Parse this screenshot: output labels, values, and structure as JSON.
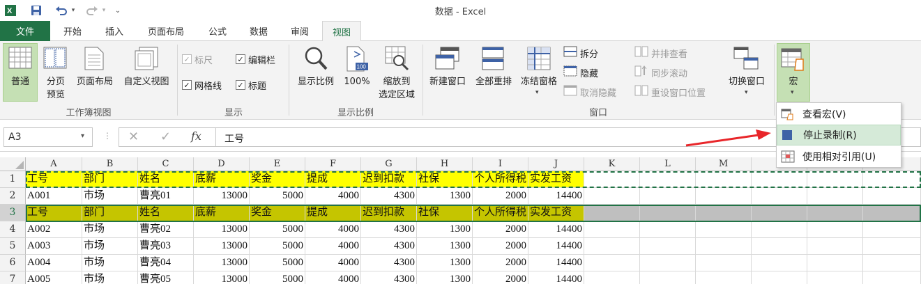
{
  "window": {
    "title": "数据 - Excel"
  },
  "quick_access": {
    "app_icon": "excel-icon",
    "save": "save-icon",
    "undo": "undo-icon",
    "redo": "redo-icon",
    "customize": "customize-qat-icon"
  },
  "tabs": [
    {
      "label": "文件"
    },
    {
      "label": "开始"
    },
    {
      "label": "插入"
    },
    {
      "label": "页面布局"
    },
    {
      "label": "公式"
    },
    {
      "label": "数据"
    },
    {
      "label": "审阅"
    },
    {
      "label": "视图",
      "active": true
    }
  ],
  "ribbon": {
    "groups": {
      "workbook_views": {
        "label": "工作簿视图",
        "normal": "普通",
        "page_break_1": "分页",
        "page_break_2": "预览",
        "page_layout": "页面布局",
        "custom_view": "自定义视图"
      },
      "show": {
        "label": "显示",
        "ruler": "标尺",
        "ruler_checked": true,
        "ruler_disabled": true,
        "formula_bar": "编辑栏",
        "formula_bar_checked": true,
        "gridlines": "网格线",
        "gridlines_checked": true,
        "headings": "标题",
        "headings_checked": true
      },
      "zoom": {
        "label": "显示比例",
        "zoom": "显示比例",
        "hundred": "100%",
        "hundred_icon_text": "100",
        "zoom_selection_1": "缩放到",
        "zoom_selection_2": "选定区域"
      },
      "window": {
        "label": "窗口",
        "new_window": "新建窗口",
        "arrange_all": "全部重排",
        "freeze_panes": "冻结窗格",
        "split": "拆分",
        "hide": "隐藏",
        "unhide": "取消隐藏",
        "view_side_by_side": "并排查看",
        "sync_scroll": "同步滚动",
        "reset_position": "重设窗口位置",
        "switch_windows": "切换窗口"
      },
      "macros": {
        "macro": "宏"
      }
    }
  },
  "formula_bar": {
    "name_box": "A3",
    "cancel": "✕",
    "enter": "✓",
    "fx": "fx",
    "content": "工号"
  },
  "macro_menu": {
    "items": [
      {
        "label": "查看宏(V)",
        "icon": "view-macros-icon"
      },
      {
        "label": "停止录制(R)",
        "icon": "stop-recording-icon",
        "highlighted": true
      },
      {
        "label": "使用相对引用(U)",
        "icon": "relative-reference-icon"
      }
    ]
  },
  "sheet": {
    "columns": [
      "A",
      "B",
      "C",
      "D",
      "E",
      "F",
      "G",
      "H",
      "I",
      "J",
      "K",
      "L",
      "M"
    ],
    "row_numbers": [
      "1",
      "2",
      "3",
      "4",
      "5",
      "6",
      "7"
    ],
    "rows": [
      [
        "工号",
        "部门",
        "姓名",
        "底薪",
        "奖金",
        "提成",
        "迟到扣款",
        "社保",
        "个人所得税",
        "实发工资"
      ],
      [
        "A001",
        "市场",
        "曹亮01",
        "13000",
        "5000",
        "4000",
        "4300",
        "1300",
        "2000",
        "14400"
      ],
      [
        "工号",
        "部门",
        "姓名",
        "底薪",
        "奖金",
        "提成",
        "迟到扣款",
        "社保",
        "个人所得税",
        "实发工资"
      ],
      [
        "A002",
        "市场",
        "曹亮02",
        "13000",
        "5000",
        "4000",
        "4300",
        "1300",
        "2000",
        "14400"
      ],
      [
        "A003",
        "市场",
        "曹亮03",
        "13000",
        "5000",
        "4000",
        "4300",
        "1300",
        "2000",
        "14400"
      ],
      [
        "A004",
        "市场",
        "曹亮04",
        "13000",
        "5000",
        "4000",
        "4300",
        "1300",
        "2000",
        "14400"
      ],
      [
        "A005",
        "市场",
        "曹亮05",
        "13000",
        "5000",
        "4000",
        "4300",
        "1300",
        "2000",
        "14400"
      ]
    ],
    "colors": {
      "header_fill": "#ffff00",
      "selected_header_fill": "#c5c500",
      "selected_row_fill": "#bfbfbf",
      "excel_green": "#217346",
      "annotation_arrow": "#e8262a"
    }
  }
}
